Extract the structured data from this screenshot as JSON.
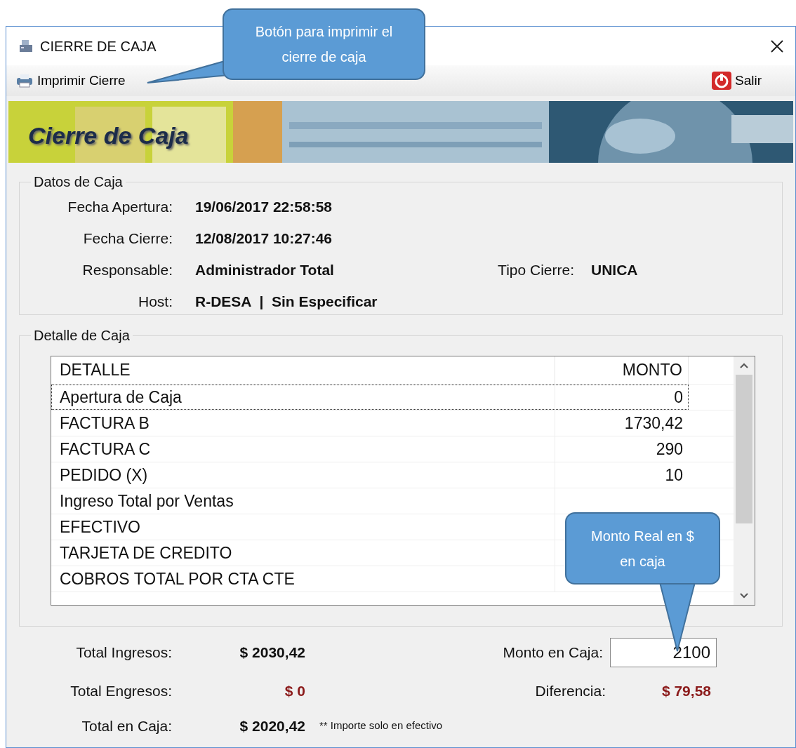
{
  "window": {
    "title": "CIERRE DE CAJA"
  },
  "toolbar": {
    "print_button": "Imprimir Cierre",
    "exit_button": "Salir"
  },
  "banner": {
    "title": "Cierre de Caja"
  },
  "datos": {
    "legend": "Datos de Caja",
    "fields": [
      {
        "label": "Fecha Apertura:",
        "value": "19/06/2017 22:58:58"
      },
      {
        "label": "Fecha Cierre:",
        "value": "12/08/2017 10:27:46"
      },
      {
        "label": "Responsable:",
        "value": "Administrador Total",
        "extra_label": "Tipo Cierre:",
        "extra_value": "UNICA"
      },
      {
        "label": "Host:",
        "value": "R-DESA  |  Sin Especificar"
      }
    ]
  },
  "detalle": {
    "legend": "Detalle de Caja",
    "columns": [
      "DETALLE",
      "MONTO"
    ],
    "rows": [
      {
        "detalle": "Apertura de Caja",
        "monto": "0",
        "selected": true
      },
      {
        "detalle": "FACTURA B",
        "monto": "1730,42",
        "selected": false
      },
      {
        "detalle": "FACTURA C",
        "monto": "290",
        "selected": false
      },
      {
        "detalle": "PEDIDO (X)",
        "monto": "10",
        "selected": false
      },
      {
        "detalle": "Ingreso Total por Ventas",
        "selected": false
      },
      {
        "detalle": "EFECTIVO",
        "selected": false
      },
      {
        "detalle": "TARJETA DE CREDITO",
        "selected": false
      },
      {
        "detalle": "COBROS TOTAL POR CTA CTE",
        "selected": false
      }
    ]
  },
  "totals": {
    "ingresos_label": "Total Ingresos:",
    "ingresos": "$ 2030,42",
    "engresos_label": "Total Engresos:",
    "engresos": "$ 0",
    "caja_label": "Total en Caja:",
    "caja": "$ 2020,42",
    "note": "** Importe solo en efectivo",
    "monto_label": "Monto en Caja:",
    "monto_value": "2100",
    "diferencia_label": "Diferencia:",
    "diferencia": "$ 79,58"
  },
  "callouts": [
    {
      "text": "Botón para imprimir el cierre de caja",
      "kind": "print"
    },
    {
      "text": "Monto Real en $ en caja",
      "kind": "monto"
    }
  ]
}
